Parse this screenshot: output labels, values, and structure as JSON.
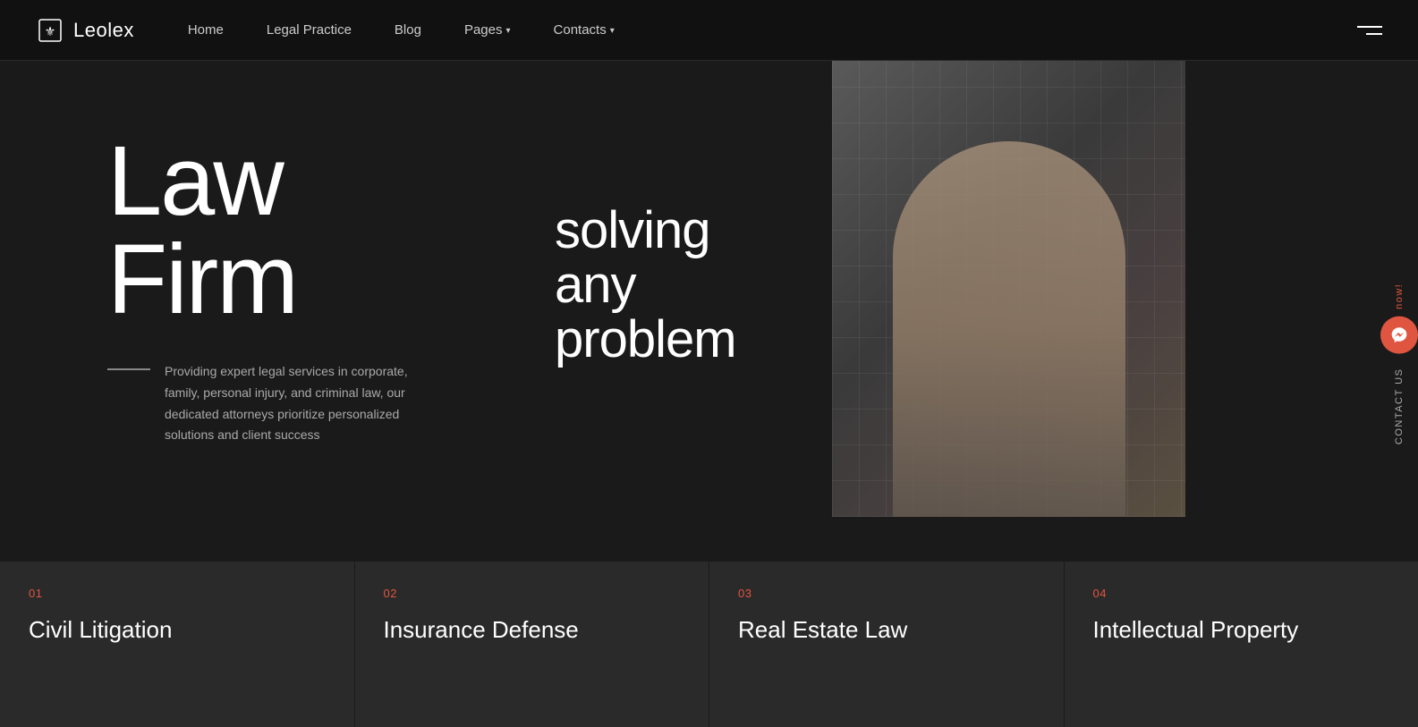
{
  "brand": {
    "name_part1": "Leo",
    "name_part2": "lex",
    "logo_alt": "Leolex logo"
  },
  "nav": {
    "links": [
      {
        "label": "Home",
        "has_dropdown": false
      },
      {
        "label": "Legal Practice",
        "has_dropdown": false
      },
      {
        "label": "Blog",
        "has_dropdown": false
      },
      {
        "label": "Pages",
        "has_dropdown": true
      },
      {
        "label": "Contacts",
        "has_dropdown": true
      }
    ]
  },
  "hero": {
    "title_line1": "Law",
    "title_line2": "Firm",
    "tagline_line1": "solving",
    "tagline_line2": "any",
    "tagline_line3": "problem",
    "description": "Providing expert legal services in corporate, family, personal injury, and criminal law, our dedicated attorneys prioritize personalized solutions and client success"
  },
  "contact_side": {
    "label": "Contact us",
    "now_label": "now!"
  },
  "cards": [
    {
      "number": "01",
      "title": "Civil Litigation"
    },
    {
      "number": "02",
      "title": "Insurance Defense"
    },
    {
      "number": "03",
      "title": "Real Estate Law"
    },
    {
      "number": "04",
      "title": "Intellectual Property"
    }
  ],
  "colors": {
    "accent": "#e05540",
    "bg_dark": "#111111",
    "bg_main": "#1a1a1a",
    "bg_card": "#2a2a2a"
  }
}
